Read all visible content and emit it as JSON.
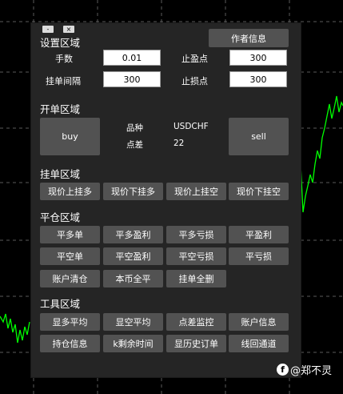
{
  "window": {
    "minimize_label": "-",
    "close_label": "×"
  },
  "settings": {
    "title": "设置区域",
    "author_button": "作者信息",
    "lots_label": "手数",
    "lots_value": "0.01",
    "tp_label": "止盈点",
    "tp_value": "300",
    "pending_label": "挂单间隔",
    "pending_value": "300",
    "sl_label": "止损点",
    "sl_value": "300"
  },
  "open": {
    "title": "开单区域",
    "buy": "buy",
    "sell": "sell",
    "symbol_label": "品种",
    "symbol_value": "USDCHF",
    "spread_label": "点差",
    "spread_value": "22"
  },
  "pending": {
    "title": "挂单区域",
    "buttons": [
      "现价上挂多",
      "现价下挂多",
      "现价上挂空",
      "现价下挂空"
    ]
  },
  "close": {
    "title": "平仓区域",
    "buttons": [
      "平多单",
      "平多盈利",
      "平多亏损",
      "平盈利",
      "平空单",
      "平空盈利",
      "平空亏损",
      "平亏损",
      "账户清仓",
      "本币全平",
      "挂单全删"
    ]
  },
  "tools": {
    "title": "工具区域",
    "buttons": [
      "显多平均",
      "显空平均",
      "点差监控",
      "账户信息",
      "持仓信息",
      "k剩余时间",
      "显历史订单",
      "线回通道"
    ]
  },
  "watermark": {
    "icon": "f",
    "text": "@郑不灵"
  }
}
